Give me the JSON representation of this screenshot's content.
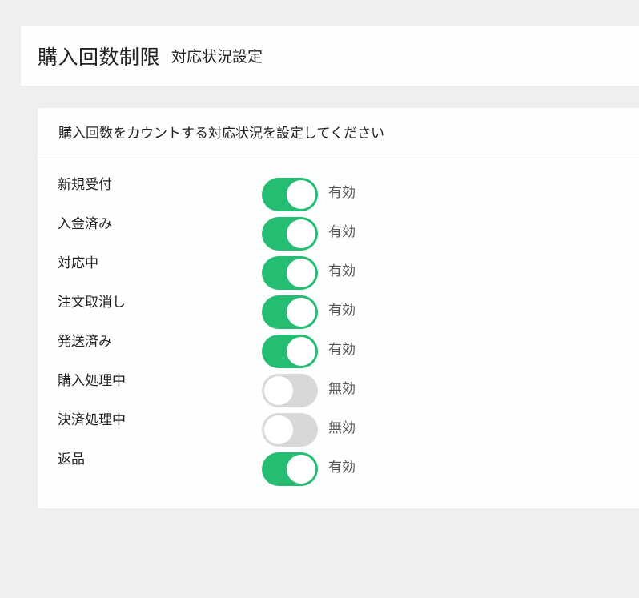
{
  "header": {
    "title": "購入回数制限",
    "subtitle": "対応状況設定"
  },
  "card": {
    "description": "購入回数をカウントする対応状況を設定してください"
  },
  "settings": [
    {
      "label": "新規受付",
      "enabled": true,
      "state_text": "有効"
    },
    {
      "label": "入金済み",
      "enabled": true,
      "state_text": "有効"
    },
    {
      "label": "対応中",
      "enabled": true,
      "state_text": "有効"
    },
    {
      "label": "注文取消し",
      "enabled": true,
      "state_text": "有効"
    },
    {
      "label": "発送済み",
      "enabled": true,
      "state_text": "有効"
    },
    {
      "label": "購入処理中",
      "enabled": false,
      "state_text": "無効"
    },
    {
      "label": "決済処理中",
      "enabled": false,
      "state_text": "無効"
    },
    {
      "label": "返品",
      "enabled": true,
      "state_text": "有効"
    }
  ],
  "colors": {
    "toggle_on": "#25bd72",
    "toggle_off": "#d8d8d8"
  }
}
